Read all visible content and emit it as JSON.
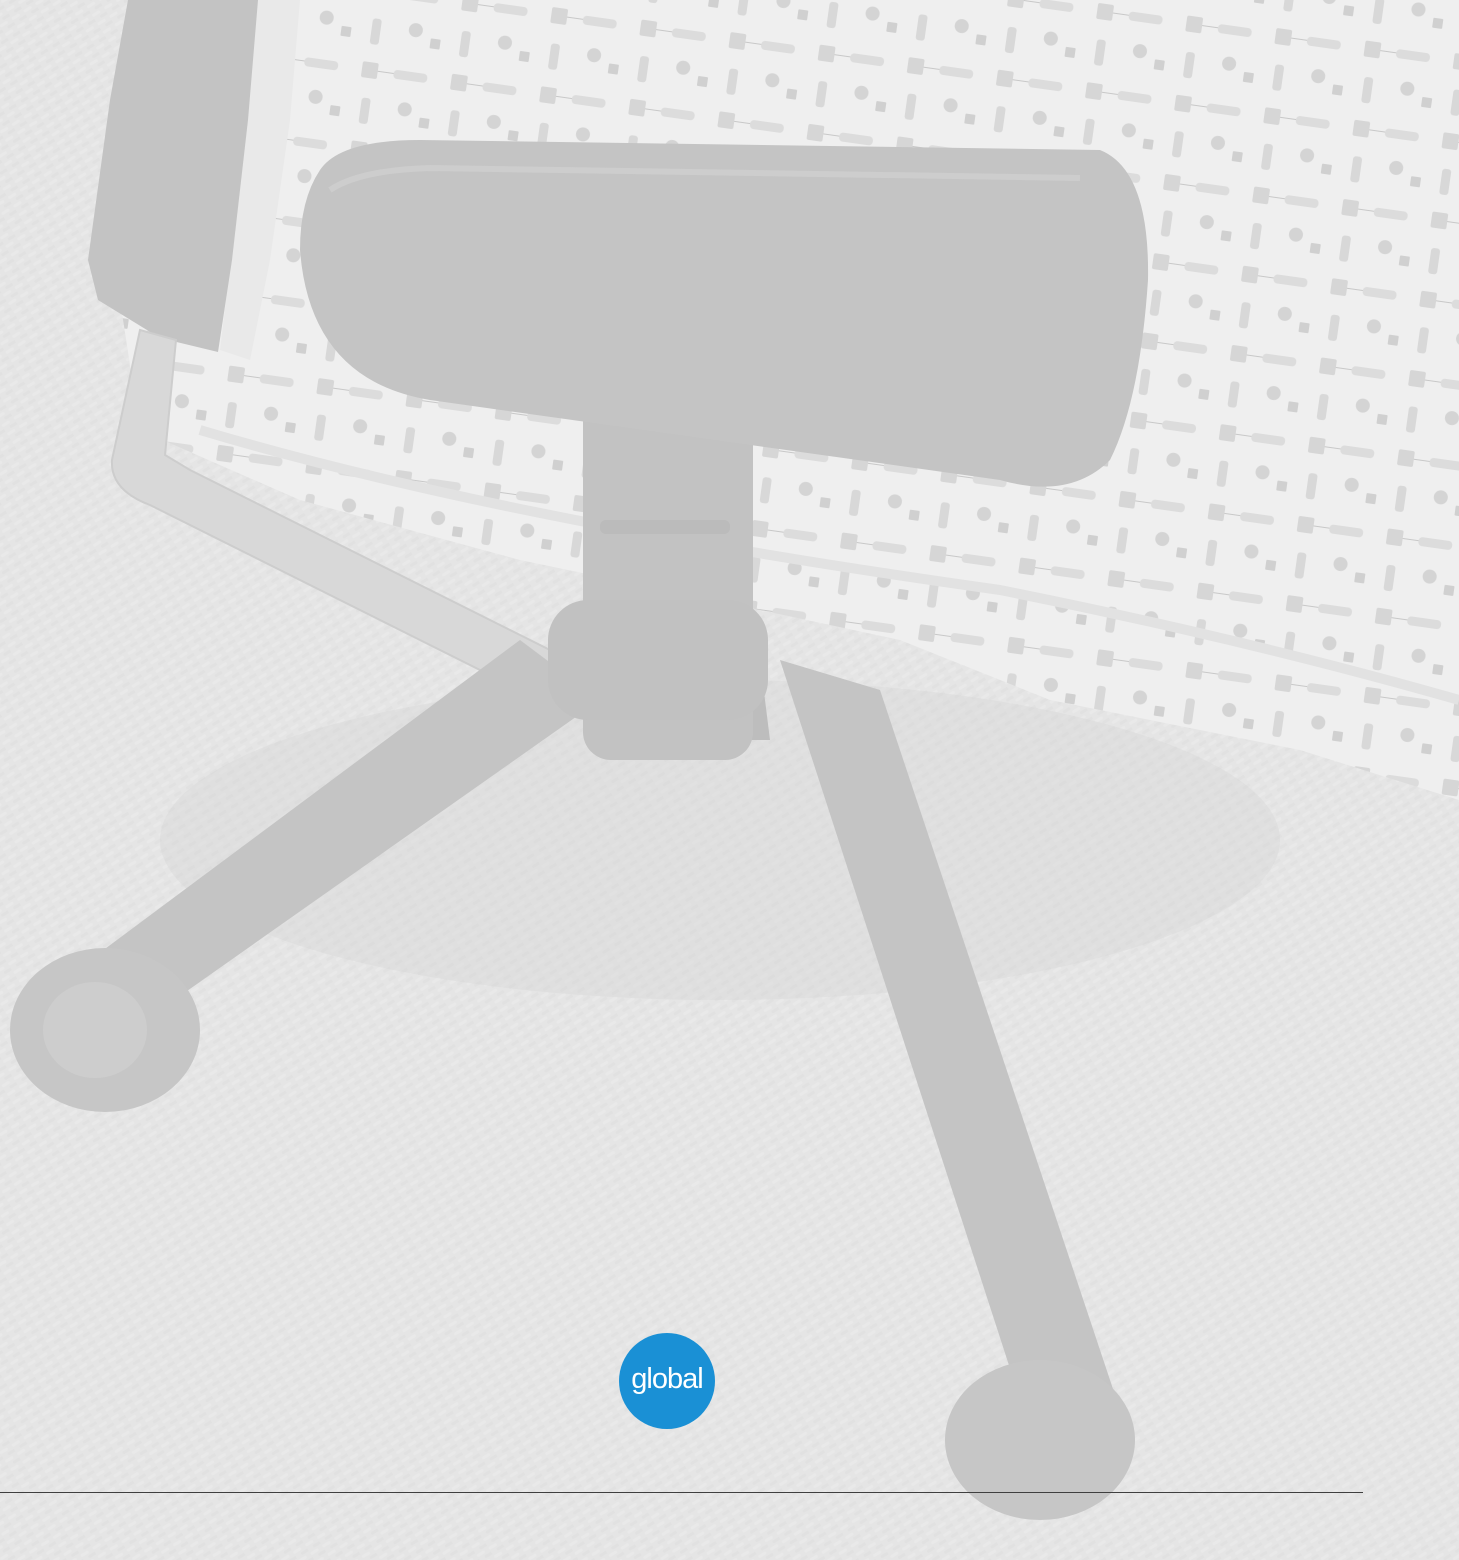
{
  "photo": {
    "subject": "office-chair-base-on-carpet",
    "tone": "grayscale-faded"
  },
  "logo": {
    "text": "global",
    "color": "#1a90d5"
  },
  "colors": {
    "background": "#e6e6e6",
    "rule": "#3f3f3f",
    "fabric": "#efefef",
    "chair_parts": "#c4c4c4",
    "frame": "#d9d9d9"
  }
}
